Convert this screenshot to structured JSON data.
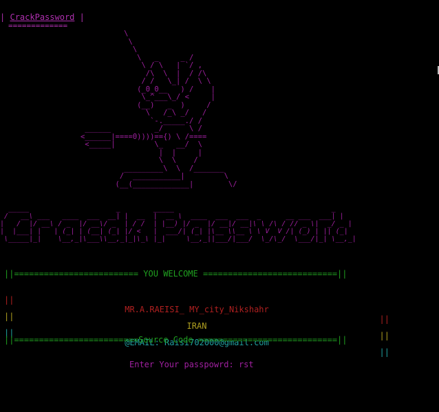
{
  "window": {
    "title": "CrackPassword",
    "title_left_pipe": "|",
    "title_right_pipe": "|",
    "title_underline": "============="
  },
  "ascii_art": {
    "cat": "             \\\n              \\\n               \\\n                \\   _     _ /\n                 \\ / \\   | `/ ,\n                  /\\  \\  |  / /\\\n                 / /   \\_| /  \\ \\\n                (_0_0__   ) /    |\n                 \\_^___\\_/ <     |\n                (__)   _  )     /\n                  \\   /_\\ _/   /\n                   `-._____./ /\n    ______          _/      \\ /\n   <______|====0))))=={) \\ /====\n    <_____|         \\_   __/  \\\n                     |  |     |\n                     \\  \\    /\n             _________\\  \\  /_______\n            /  ___________|         \\\n           (__(_____________|        \\/",
    "banner": "  _____                     _        _____                                      _ \n /   __\\ ___   ____  ___  __| |  __  |  __ \\  ____  ___  ___  _      __ ___  ___| |\n|   /  |/ __\\ / _  |/ __\\/ _  | / /  | |__) |/ _  |/ __|/ __|\\ \\ /\\ / // _ \\|  _/ _ |\n|  |___| |   | (_| | (__| (_| |/ <   |  ___/| (_| |\\__ \\\\__ \\ \\ V  V /| (_) | || (_|\n \\_____|_|    \\__,_|\\___\\\\__,_|_|\\_\\ |_|     \\__,_||___/|___/  \\_/\\_/  \\___/|_| \\__,_|"
  },
  "info_box": {
    "welcome": "YOU WELCOME",
    "welcome_line": "||========================= YOU WELCOME ===========================||",
    "author": "MR.A.RAEISI_ MY_city_Nikshahr",
    "country": "IRAN",
    "email": "@EMAIL: Raisi702000@gmail.com",
    "source_line": "||=========================Source Code ============================||",
    "left_border": "||",
    "right_border": "||"
  },
  "prompt": {
    "label": "Enter Your passpowrd:",
    "value": "rst"
  },
  "colors": {
    "background": "#000000",
    "magenta": "#a020a0",
    "green": "#20a020",
    "red": "#b02020",
    "yellow": "#b0a020",
    "cyan": "#20a0a0"
  }
}
